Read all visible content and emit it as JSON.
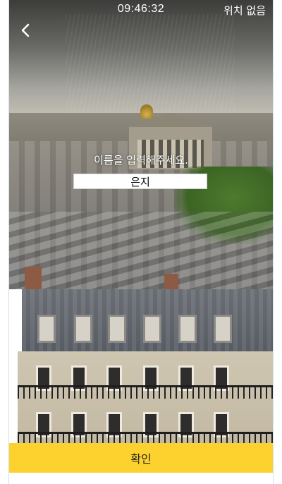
{
  "status_bar": {
    "time": "09:46:32",
    "location": "위치 없음"
  },
  "navigation": {
    "back_icon": "chevron-left-icon"
  },
  "name_prompt": {
    "label": "이름을 입력해주세요.",
    "input_value": "은지"
  },
  "confirm": {
    "label": "확인"
  },
  "colors": {
    "confirm_button": "#fdd12e",
    "status_text": "#ffffff"
  }
}
